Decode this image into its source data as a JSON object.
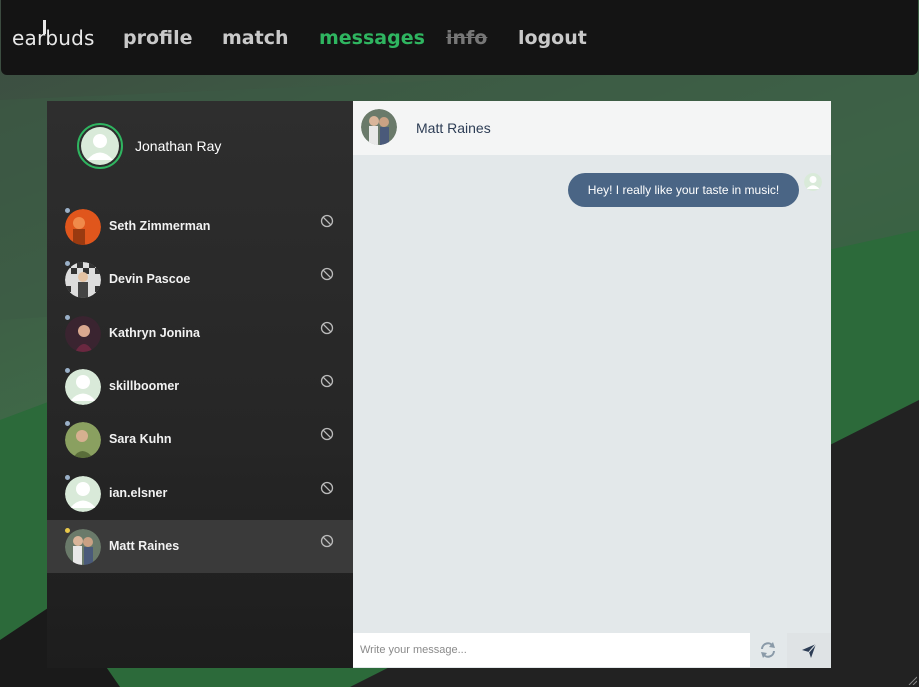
{
  "app": {
    "logo": "earbuds"
  },
  "nav": {
    "profile": "profile",
    "match": "match",
    "messages": "messages",
    "info": "info",
    "logout": "logout"
  },
  "me": {
    "name": "Jonathan Ray"
  },
  "contacts": [
    {
      "name": "Seth Zimmerman",
      "avatar": "photo-orange"
    },
    {
      "name": "Devin Pascoe",
      "avatar": "photo-checker"
    },
    {
      "name": "Kathryn Jonina",
      "avatar": "photo-dark"
    },
    {
      "name": "skillboomer",
      "avatar": "default-user-icon"
    },
    {
      "name": "Sara Kuhn",
      "avatar": "photo-green"
    },
    {
      "name": "ian.elsner",
      "avatar": "default-user-icon"
    },
    {
      "name": "Matt Raines",
      "avatar": "photo-couple",
      "selected": true
    }
  ],
  "chat": {
    "title": "Matt Raines",
    "messages": [
      {
        "text": "Hey! I really like your taste in music!",
        "from": "me"
      }
    ],
    "input_placeholder": "Write your message..."
  },
  "colors": {
    "accent": "#2fb560",
    "bubble": "#4a6585",
    "header_text": "#2d3d55"
  },
  "icons": {
    "block": "block-icon",
    "refresh": "refresh-icon",
    "send": "send-icon",
    "user": "user-icon"
  }
}
